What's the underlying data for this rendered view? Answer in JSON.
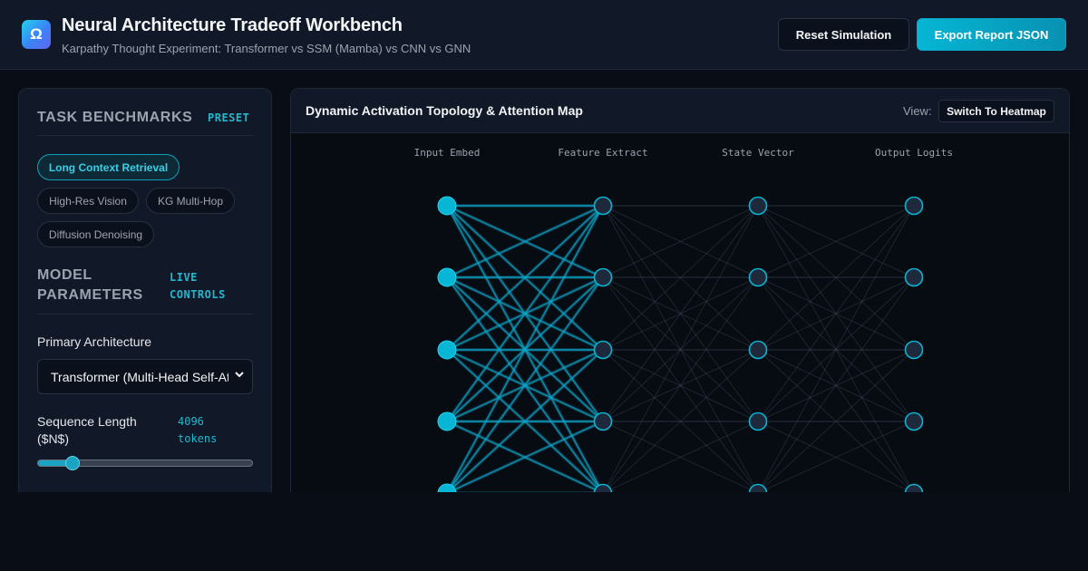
{
  "header": {
    "logo_glyph": "Ω",
    "title": "Neural Architecture Tradeoff Workbench",
    "subtitle": "Karpathy Thought Experiment: Transformer vs SSM (Mamba) vs CNN vs GNN",
    "reset_label": "Reset Simulation",
    "export_label": "Export Report JSON"
  },
  "sidebar": {
    "benchmarks": {
      "title": "TASK BENCHMARKS",
      "tag": "PRESET",
      "chips": [
        {
          "label": "Long Context Retrieval",
          "active": true
        },
        {
          "label": "High-Res Vision",
          "active": false
        },
        {
          "label": "KG Multi-Hop",
          "active": false
        },
        {
          "label": "Diffusion Denoising",
          "active": false
        }
      ]
    },
    "params": {
      "title_line1": "MODEL",
      "title_line2": "PARAMETERS",
      "tag_line1": "LIVE",
      "tag_line2": "CONTROLS",
      "arch_label": "Primary Architecture",
      "arch_value": "Transformer (Multi-Head Self-Attention)",
      "seq_label_line1": "Sequence Length",
      "seq_label_line2": "($N$)",
      "seq_value_line1": "4096",
      "seq_value_line2": "tokens",
      "seq_slider_fraction": 0.14
    }
  },
  "panel": {
    "title": "Dynamic Activation Topology & Attention Map",
    "view_label": "View:",
    "view_button": "Switch To Heatmap",
    "layers": [
      "Input Embed",
      "Feature Extract",
      "State Vector",
      "Output Logits"
    ]
  },
  "colors": {
    "accent": "#06b6d4",
    "active_edge": "#0ea5c9",
    "dim_edge": "#475569",
    "node_fill": "#1e293b"
  }
}
